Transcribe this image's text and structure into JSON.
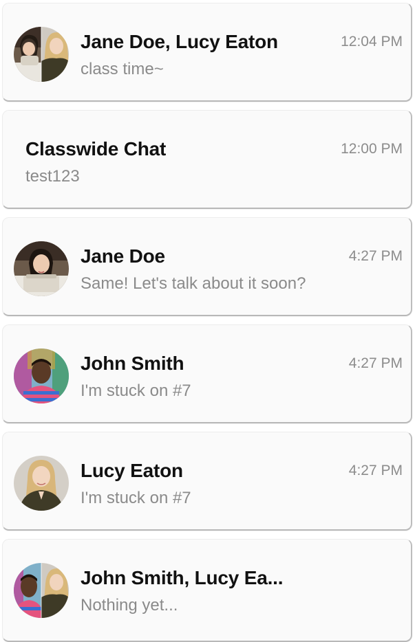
{
  "conversations": [
    {
      "name": "Jane Doe, Lucy Eaton",
      "preview": "class time~",
      "time": "12:04 PM",
      "avatar": "jane-lucy-group-avatar"
    },
    {
      "name": "Classwide Chat",
      "preview": "test123",
      "time": "12:00 PM",
      "avatar": ""
    },
    {
      "name": "Jane Doe",
      "preview": "Same! Let's talk about it soon?",
      "time": "4:27 PM",
      "avatar": "jane-avatar"
    },
    {
      "name": "John Smith",
      "preview": "I'm stuck on #7",
      "time": "4:27 PM",
      "avatar": "john-avatar"
    },
    {
      "name": "Lucy Eaton",
      "preview": "I'm stuck on #7",
      "time": "4:27 PM",
      "avatar": "lucy-avatar"
    },
    {
      "name": "John Smith, Lucy Ea...",
      "preview": "Nothing yet...",
      "time": "",
      "avatar": "john-lucy-group-avatar"
    }
  ],
  "colors": {
    "name_text": "#111111",
    "preview_text": "#8a8a8a",
    "time_text": "#8c8c8c",
    "card_background": "#fafafa"
  }
}
